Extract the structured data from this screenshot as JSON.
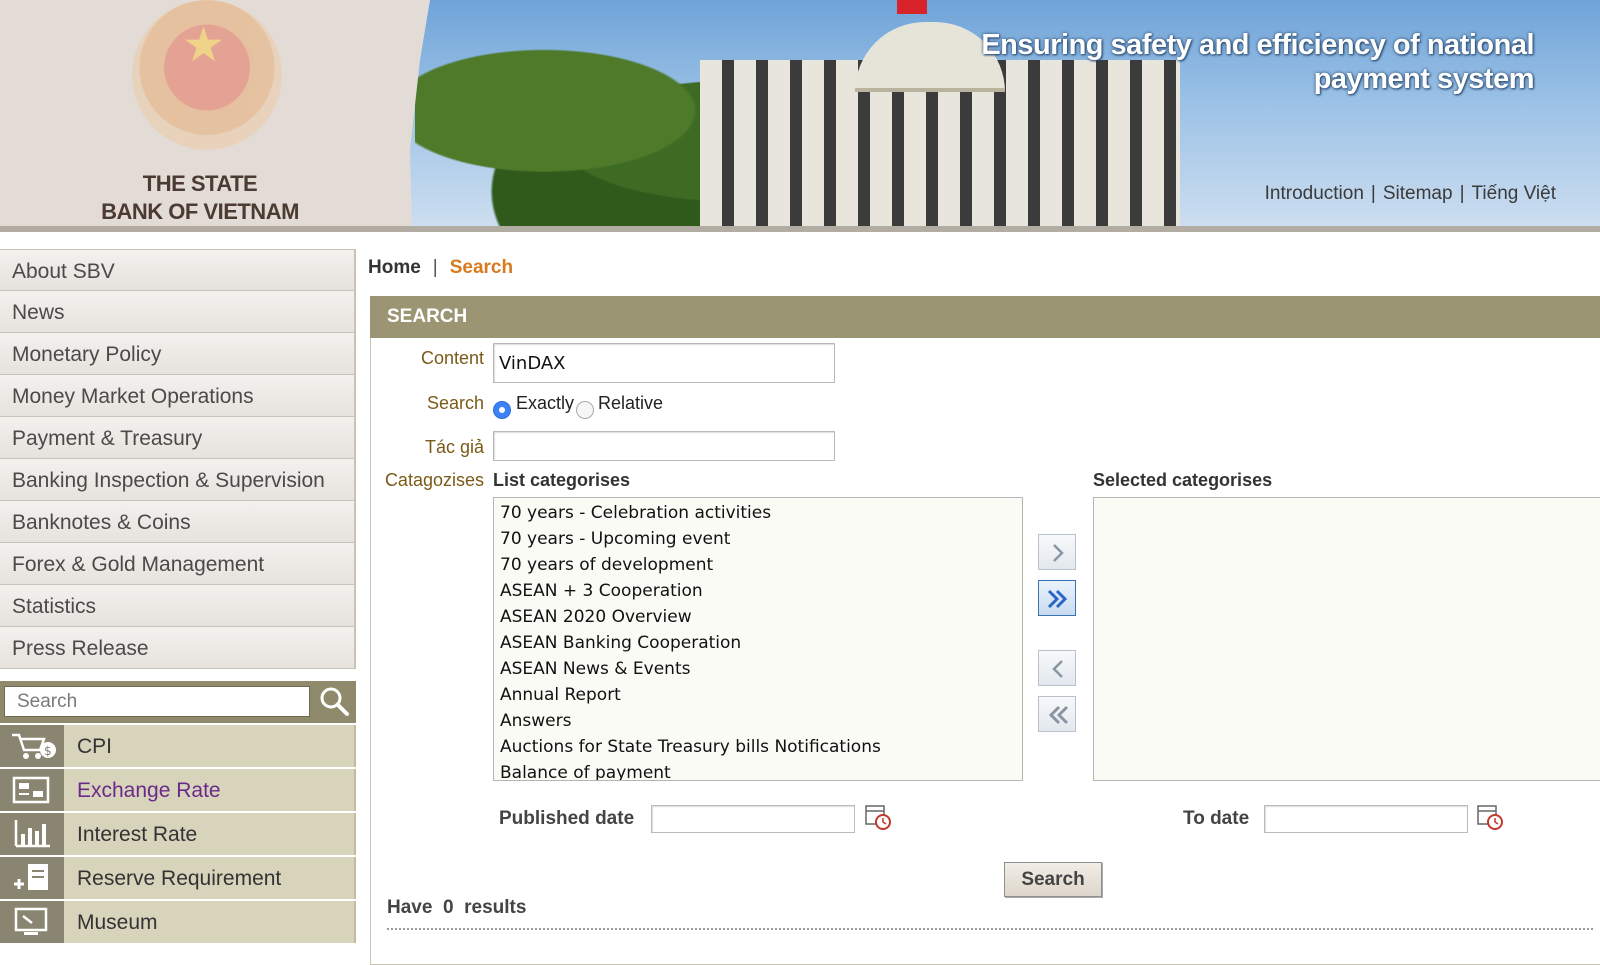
{
  "banner": {
    "bank_name_line1": "THE STATE",
    "bank_name_line2": "BANK OF VIETNAM",
    "slogan_line1": "Ensuring safety and efficiency of national",
    "slogan_line2": "payment system",
    "links": [
      "Introduction",
      "Sitemap",
      "Tiếng Việt"
    ]
  },
  "menu": {
    "items": [
      "About SBV",
      "News",
      "Monetary Policy",
      "Money Market Operations",
      "Payment & Treasury",
      "Banking Inspection & Supervision",
      "Banknotes & Coins",
      "Forex & Gold Management",
      "Statistics",
      "Press Release"
    ]
  },
  "left_search": {
    "placeholder": "Search"
  },
  "quicklinks": [
    {
      "label": "CPI",
      "icon": "cart-icon"
    },
    {
      "label": "Exchange Rate",
      "icon": "exchange-icon"
    },
    {
      "label": "Interest Rate",
      "icon": "bar-chart-icon"
    },
    {
      "label": "Reserve Requirement",
      "icon": "reserve-icon"
    },
    {
      "label": "Museum",
      "icon": "monitor-icon"
    }
  ],
  "breadcrumb": {
    "home": "Home",
    "current": "Search"
  },
  "panel": {
    "title": "SEARCH"
  },
  "form": {
    "content_label": "Content",
    "content_value": "VinDAX",
    "search_label": "Search",
    "exactly_label": "Exactly",
    "relative_label": "Relative",
    "author_label": "Tác giả",
    "author_value": "",
    "categories_label": "Catagozises",
    "list_header": "List categorises",
    "selected_header": "Selected categorises",
    "categories": [
      "70 years - Celebration activities",
      "70 years - Upcoming event",
      "70 years of development",
      "ASEAN + 3 Cooperation",
      "ASEAN 2020 Overview",
      "ASEAN Banking Cooperation",
      "ASEAN News & Events",
      "Annual Report",
      "Answers",
      "Auctions for State Treasury bills Notifications",
      "Balance of payment"
    ],
    "published_label": "Published date",
    "to_label": "To date",
    "submit_label": "Search"
  },
  "result": {
    "prefix": "Have",
    "count": "0",
    "suffix": "results"
  },
  "colors": {
    "panel_header": "#9b9573",
    "breadcrumb_active": "#d97a1e",
    "link_visited": "#6a2a8a"
  }
}
